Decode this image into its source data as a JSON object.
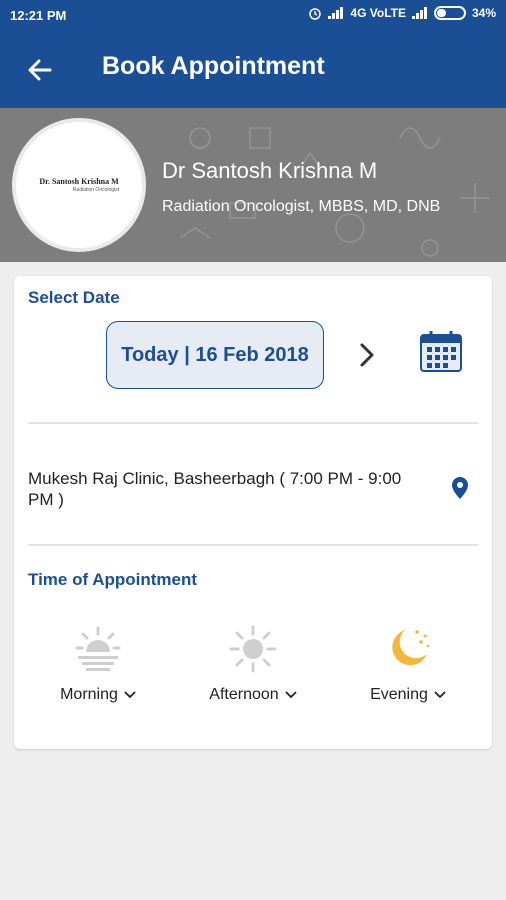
{
  "status": {
    "time": "12:21 PM",
    "network": "4G VoLTE",
    "battery": "34%"
  },
  "header": {
    "title": "Book Appointment"
  },
  "doctor": {
    "logo_name": "Dr. Santosh Krishna M",
    "logo_sub": "Radiation Oncologist",
    "name": "Dr Santosh Krishna M",
    "specialization": "Radiation Oncologist, MBBS, MD, DNB"
  },
  "select_date": {
    "title": "Select Date",
    "value": "Today | 16 Feb 2018"
  },
  "clinic": {
    "text": "Mukesh Raj Clinic, Basheerbagh ( 7:00 PM - 9:00 PM )"
  },
  "time_of_appointment": {
    "title": "Time of Appointment",
    "slots": [
      {
        "label": "Morning",
        "icon": "sunrise-icon",
        "color": "#cfcfcf"
      },
      {
        "label": "Afternoon",
        "icon": "sun-icon",
        "color": "#cfcfcf"
      },
      {
        "label": "Evening",
        "icon": "moon-icon",
        "color": "#f5b73a"
      }
    ]
  },
  "colors": {
    "primary": "#1a4f95",
    "hero": "#7d7d7d",
    "background": "#eeeeee"
  }
}
